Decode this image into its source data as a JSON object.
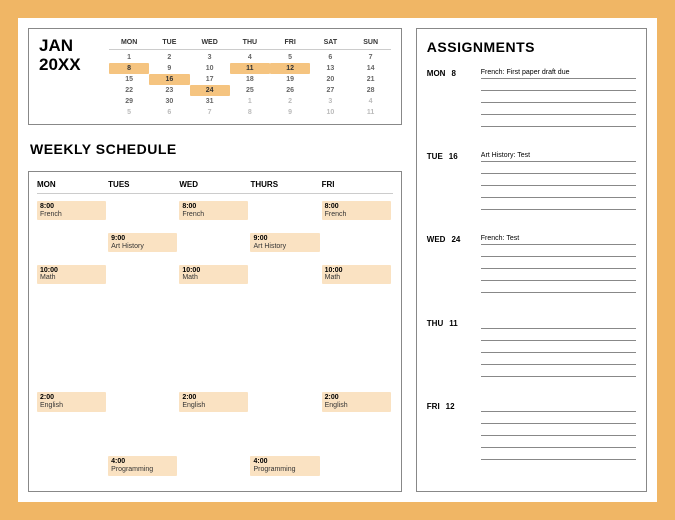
{
  "calendar": {
    "month": "JAN",
    "year": "20XX",
    "dow": [
      "MON",
      "TUE",
      "WED",
      "THU",
      "FRI",
      "SAT",
      "SUN"
    ],
    "weeks": [
      [
        {
          "n": "1",
          "dim": false
        },
        {
          "n": "2",
          "dim": false
        },
        {
          "n": "3",
          "dim": false
        },
        {
          "n": "4",
          "dim": false
        },
        {
          "n": "5",
          "dim": false
        },
        {
          "n": "6",
          "dim": false
        },
        {
          "n": "7",
          "dim": false
        }
      ],
      [
        {
          "n": "8",
          "hl": true
        },
        {
          "n": "9"
        },
        {
          "n": "10"
        },
        {
          "n": "11",
          "hl": true
        },
        {
          "n": "12",
          "hl": true
        },
        {
          "n": "13"
        },
        {
          "n": "14"
        }
      ],
      [
        {
          "n": "15"
        },
        {
          "n": "16",
          "hl": true
        },
        {
          "n": "17"
        },
        {
          "n": "18"
        },
        {
          "n": "19"
        },
        {
          "n": "20"
        },
        {
          "n": "21"
        }
      ],
      [
        {
          "n": "22"
        },
        {
          "n": "23"
        },
        {
          "n": "24",
          "hl": true
        },
        {
          "n": "25"
        },
        {
          "n": "26"
        },
        {
          "n": "27"
        },
        {
          "n": "28"
        }
      ],
      [
        {
          "n": "29"
        },
        {
          "n": "30"
        },
        {
          "n": "31"
        },
        {
          "n": "1",
          "dim": true
        },
        {
          "n": "2",
          "dim": true
        },
        {
          "n": "3",
          "dim": true
        },
        {
          "n": "4",
          "dim": true
        }
      ],
      [
        {
          "n": "5",
          "dim": true
        },
        {
          "n": "6",
          "dim": true
        },
        {
          "n": "7",
          "dim": true
        },
        {
          "n": "8",
          "dim": true
        },
        {
          "n": "9",
          "dim": true
        },
        {
          "n": "10",
          "dim": true
        },
        {
          "n": "11",
          "dim": true
        }
      ]
    ]
  },
  "weekly": {
    "title": "WEEKLY SCHEDULE",
    "days": [
      "MON",
      "TUES",
      "WED",
      "THURS",
      "FRI"
    ],
    "rows": [
      [
        {
          "time": "8:00",
          "class": "French"
        },
        null,
        {
          "time": "8:00",
          "class": "French"
        },
        null,
        {
          "time": "8:00",
          "class": "French"
        }
      ],
      [
        null,
        {
          "time": "9:00",
          "class": "Art History"
        },
        null,
        {
          "time": "9:00",
          "class": "Art History"
        },
        null
      ],
      [
        {
          "time": "10:00",
          "class": "Math"
        },
        null,
        {
          "time": "10:00",
          "class": "Math"
        },
        null,
        {
          "time": "10:00",
          "class": "Math"
        }
      ],
      [
        null,
        null,
        null,
        null,
        null
      ],
      [
        null,
        null,
        null,
        null,
        null
      ],
      [
        null,
        null,
        null,
        null,
        null
      ],
      [
        {
          "time": "2:00",
          "class": "English"
        },
        null,
        {
          "time": "2:00",
          "class": "English"
        },
        null,
        {
          "time": "2:00",
          "class": "English"
        }
      ],
      [
        null,
        null,
        null,
        null,
        null
      ],
      [
        null,
        {
          "time": "4:00",
          "class": "Programming"
        },
        null,
        {
          "time": "4:00",
          "class": "Programming"
        },
        null
      ]
    ]
  },
  "assignments": {
    "title": "ASSIGNMENTS",
    "days": [
      {
        "dow": "MON",
        "num": "8",
        "items": [
          "French: First paper draft due",
          "",
          "",
          "",
          ""
        ]
      },
      {
        "dow": "TUE",
        "num": "16",
        "items": [
          "Art History: Test",
          "",
          "",
          "",
          ""
        ]
      },
      {
        "dow": "WED",
        "num": "24",
        "items": [
          "French: Test",
          "",
          "",
          "",
          ""
        ]
      },
      {
        "dow": "THU",
        "num": "11",
        "items": [
          "",
          "",
          "",
          "",
          ""
        ]
      },
      {
        "dow": "FRI",
        "num": "12",
        "items": [
          "",
          "",
          "",
          "",
          ""
        ]
      }
    ]
  }
}
